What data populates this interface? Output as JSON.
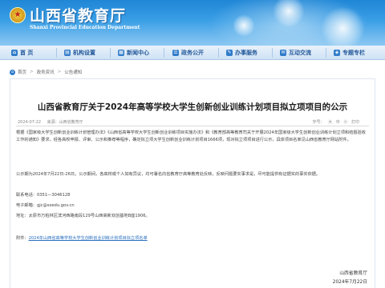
{
  "site": {
    "title": "山西省教育厅",
    "subtitle": "Shanxi Provincial Education Department"
  },
  "nav": [
    {
      "label": "首  页",
      "icon": "home-icon"
    },
    {
      "label": "机构设置",
      "icon": "organization-icon"
    },
    {
      "label": "新闻中心",
      "icon": "news-icon"
    },
    {
      "label": "政务公开",
      "icon": "document-icon"
    },
    {
      "label": "办事服务",
      "icon": "service-icon"
    },
    {
      "label": "互动交流",
      "icon": "chat-icon"
    },
    {
      "label": "专题专栏",
      "icon": "topic-icon"
    }
  ],
  "breadcrumb": {
    "home": "首页",
    "level1": "政务资讯",
    "level2": "公告通知"
  },
  "article": {
    "title": "山西省教育厅关于2024年高等学校大学生创新创业训练计划项目拟立项项目的公示",
    "date": "2024-07-22",
    "source": "来源：山西省教育厅",
    "font_label": "字号：",
    "font_sizes": [
      "大",
      "中",
      "小"
    ],
    "font_print": "打印",
    "paragraph1": "根据《国家级大学生创新创业训练计划管理办法》《山西省高等学校大学生创新创业训练项目实施办法》和《教育部高等教育司关于开展2024年国家级大学生创新创业训练计划立项和结题验收工作的通知》要求，经各高校申报、评审、公示和推荐等程序，确定拟立项大学生创新创业训练计划项目1666项，现对拟立项项目进行公示，具体项目名单见山西省教育厅网站附件。",
    "paragraph2": "公示期为2024年7月22日-26日。公示期间，各高校或个人如有异议，均可署名向省教育厅高等教育处反映，反映问题要实事求是，尽可能提供有证据实的事实依据。",
    "phone_label": "联系电话：",
    "phone": "0351—3046128",
    "email_label": "电子邮箱：",
    "email": "gjc@sxedu.gov.cn",
    "address_label": "地址：",
    "address": "太原市万柏林区滨河西路南段129号山西高新双创基地B座1906。",
    "attachment_label": "附件：",
    "attachment_link": "2024年山西省高等学校大学生创新创业训练计划项目拟立项名单",
    "sign_org": "山西省教育厅",
    "sign_date": "2024年7月22日"
  }
}
